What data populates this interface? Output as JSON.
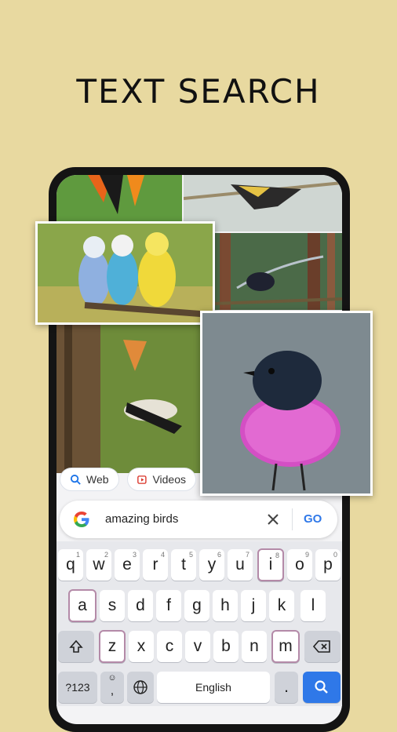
{
  "headline": "TEXT SEARCH",
  "filters": {
    "web_label": "Web",
    "videos_label": "Videos"
  },
  "search": {
    "query": "amazing birds",
    "go_label": "GO"
  },
  "keyboard": {
    "row1": [
      {
        "label": "q",
        "hint": "1"
      },
      {
        "label": "w",
        "hint": "2"
      },
      {
        "label": "e",
        "hint": "3"
      },
      {
        "label": "r",
        "hint": "4"
      },
      {
        "label": "t",
        "hint": "5"
      },
      {
        "label": "y",
        "hint": "6"
      },
      {
        "label": "u",
        "hint": "7"
      },
      {
        "label": "i",
        "hint": "8"
      },
      {
        "label": "o",
        "hint": "9"
      },
      {
        "label": "p",
        "hint": "0"
      }
    ],
    "row2": [
      "a",
      "s",
      "d",
      "f",
      "g",
      "h",
      "j",
      "k",
      "l"
    ],
    "row3": [
      "z",
      "x",
      "c",
      "v",
      "b",
      "n",
      "m"
    ],
    "symbols_label": "?123",
    "comma_label": ",",
    "space_label": "English",
    "period_label": "."
  },
  "colors": {
    "background": "#e8d9a0",
    "accent_blue": "#2f78e8",
    "key_highlight": "#b48aa8"
  }
}
